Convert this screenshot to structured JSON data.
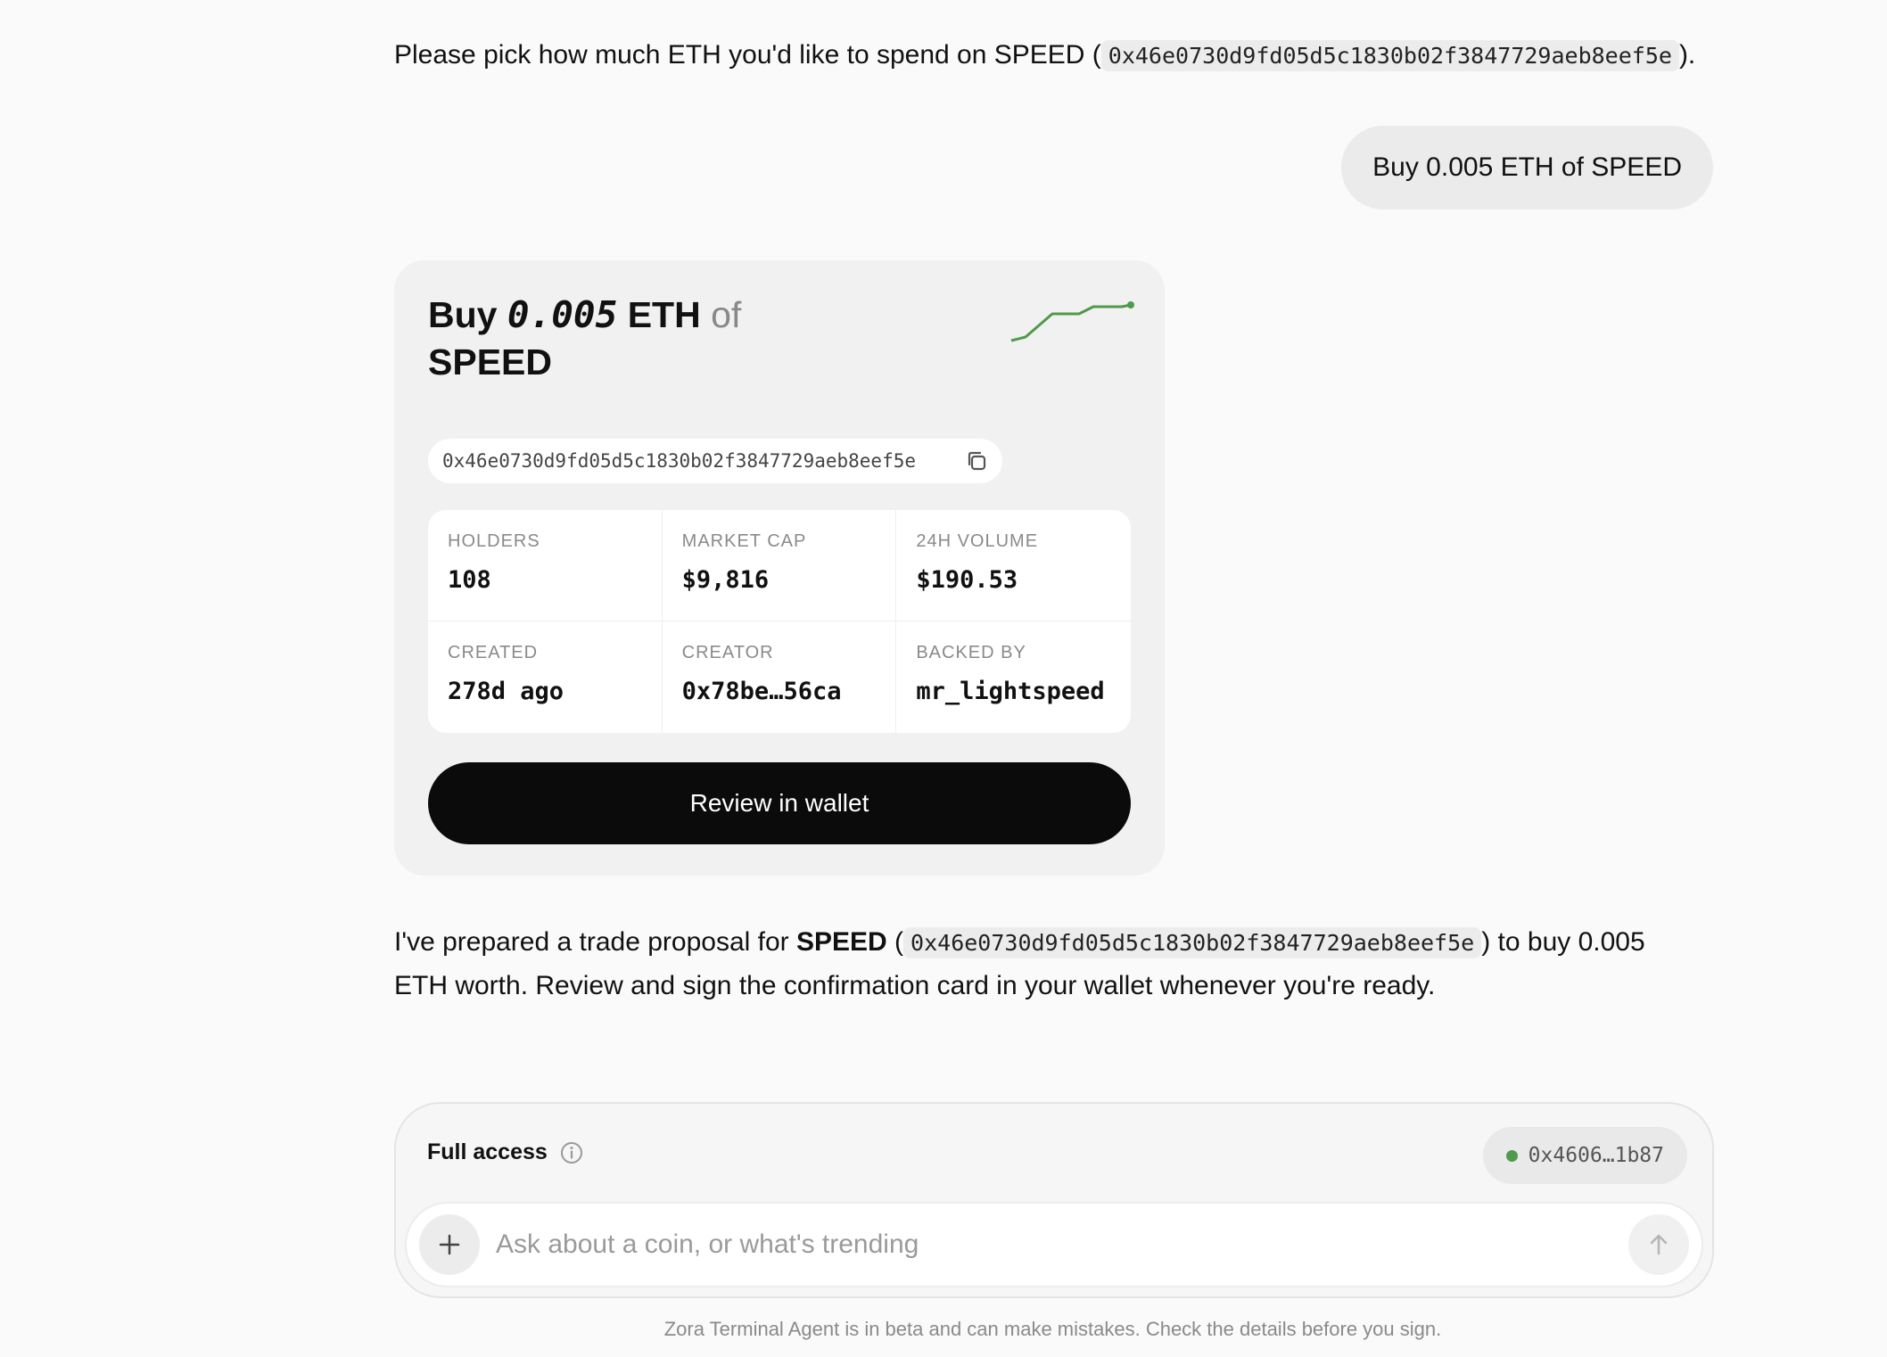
{
  "intro": {
    "text_before": "Please pick how much ETH you'd like to spend on SPEED (",
    "address": "0x46e0730d9fd05d5c1830b02f3847729aeb8eef5e",
    "text_after": ")."
  },
  "user_message": "Buy 0.005 ETH of SPEED",
  "trade_card": {
    "title_buy": "Buy",
    "title_amount": "0.005",
    "title_currency": "ETH",
    "title_of": "of",
    "title_token": "SPEED",
    "sparkline_color": "#4f9a4b",
    "address": "0x46e0730d9fd05d5c1830b02f3847729aeb8eef5e",
    "copy_icon": "copy-icon",
    "stats": [
      {
        "label": "HOLDERS",
        "value": "108"
      },
      {
        "label": "MARKET CAP",
        "value": "$9,816"
      },
      {
        "label": "24H VOLUME",
        "value": "$190.53"
      },
      {
        "label": "CREATED",
        "value": "278d ago"
      },
      {
        "label": "CREATOR",
        "value": "0x78be…56ca"
      },
      {
        "label": "BACKED BY",
        "value": "mr_lightspeed"
      }
    ],
    "review_button": "Review in wallet"
  },
  "assistant_message": {
    "part1": "I've prepared a trade proposal for ",
    "token": "SPEED",
    "part2": " (",
    "address": "0x46e0730d9fd05d5c1830b02f3847729aeb8eef5e",
    "part3": ") to buy 0.005 ETH worth. Review and sign the confirmation card in your wallet whenever you're ready."
  },
  "composer": {
    "access_label": "Full access",
    "info_icon": "info-icon",
    "wallet_address": "0x4606…1b87",
    "wallet_status_color": "#4f9a4b",
    "input_placeholder": "Ask about a coin, or what's trending",
    "input_value": "",
    "plus_icon": "plus-icon",
    "send_icon": "arrow-up-icon"
  },
  "disclaimer": "Zora Terminal Agent is in beta and can make mistakes. Check the details before you sign."
}
